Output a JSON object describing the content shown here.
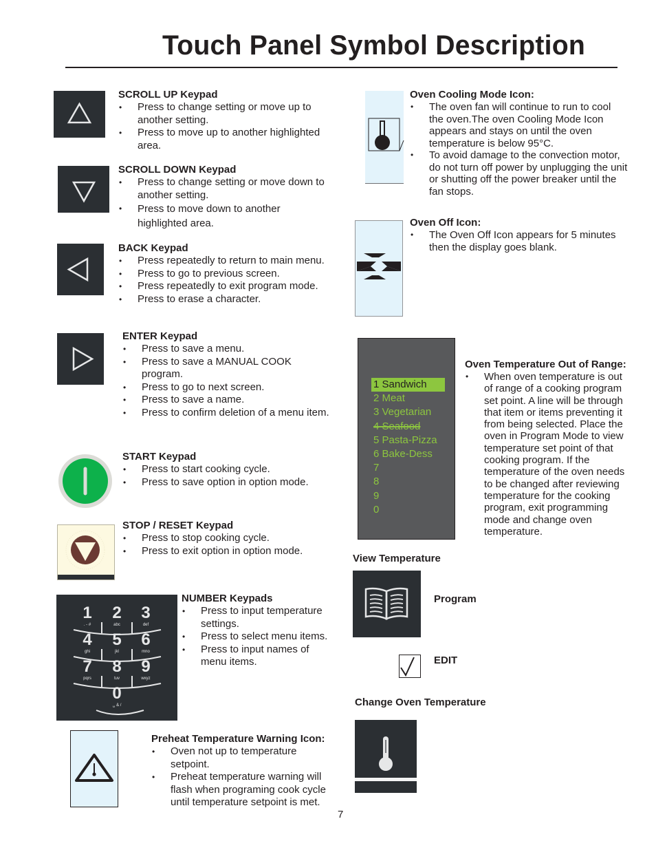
{
  "page": {
    "title": "Touch Panel Symbol Description",
    "page_number": "7"
  },
  "left_sections": {
    "scroll_up": {
      "icon": "triangle-up-icon",
      "heading": "SCROLL UP Keypad",
      "bullets": [
        "Press to change setting or move up to another setting.",
        "Press to move up to another highlighted area."
      ]
    },
    "scroll_down": {
      "icon": "triangle-down-icon",
      "heading": "SCROLL DOWN Keypad",
      "bullets": [
        "Press to change setting or move down to another setting.",
        "Press to move down to another highlighted area."
      ]
    },
    "back": {
      "icon": "triangle-left-icon",
      "heading": "BACK Keypad",
      "bullets": [
        "Press repeatedly to return to main menu.",
        "Press to go to previous screen.",
        "Press repeatedly to exit program mode.",
        "Press to erase a character."
      ]
    },
    "enter": {
      "icon": "triangle-right-icon",
      "heading": "ENTER Keypad",
      "bullets": [
        "Press to save a menu.",
        "Press to save a MANUAL COOK program.",
        "Press to go to next screen.",
        "Press to save a name.",
        "Press to confirm deletion of a menu item."
      ]
    },
    "start": {
      "icon": "start-button-icon",
      "heading": "START Keypad",
      "bullets": [
        "Press to start cooking cycle.",
        "Press to save option in option mode."
      ],
      "color": "#0db14b"
    },
    "stop": {
      "icon": "stop-reset-icon",
      "heading": "STOP / RESET Keypad",
      "bullets": [
        "Press to stop cooking cycle.",
        "Press to exit option in option mode."
      ],
      "color": "#6b3a33"
    },
    "number": {
      "icon": "number-keypad-icon",
      "heading": "NUMBER Keypads",
      "bullets": [
        "Press to input temperature settings.",
        "Press to select menu items.",
        "Press to input names of menu items."
      ],
      "keys": [
        {
          "digit": "1",
          "letters": ". - #"
        },
        {
          "digit": "2",
          "letters": "abc"
        },
        {
          "digit": "3",
          "letters": "def"
        },
        {
          "digit": "4",
          "letters": "ghi"
        },
        {
          "digit": "5",
          "letters": "jkl"
        },
        {
          "digit": "6",
          "letters": "mno"
        },
        {
          "digit": "7",
          "letters": "pqrs"
        },
        {
          "digit": "8",
          "letters": "tuv"
        },
        {
          "digit": "9",
          "letters": "wxyz"
        },
        {
          "digit": "0",
          "letters": "␣ & /"
        }
      ]
    },
    "preheat": {
      "icon": "preheat-warning-icon",
      "heading": "Preheat Temperature Warning Icon:",
      "bullets": [
        "Oven not up to temperature setpoint.",
        "Preheat temperature warning will flash when programing cook cycle until temperature setpoint is met."
      ]
    }
  },
  "right_sections": {
    "cooling": {
      "icon": "thermometer-cooling-icon",
      "heading": "Oven Cooling Mode Icon:",
      "bullets": [
        "The oven fan will continue to run to cool the oven.The oven Cooling Mode Icon appears and stays on until the oven temperature is below 95°C.",
        "To avoid damage to the convection motor, do not turn off power by unplugging the unit or shutting off the power breaker until the fan stops."
      ]
    },
    "oven_off": {
      "icon": "oven-off-x-icon",
      "heading": "Oven Off Icon:",
      "bullets": [
        "The Oven Off Icon appears for 5 minutes then the display goes blank."
      ]
    },
    "out_of_range": {
      "heading": "Oven Temperature Out of Range:",
      "bullets": [
        "When oven temperature is out of range of a cooking program set point. A line will be through that item or items preventing it from being selected. Place the oven in Program Mode to view temperature set point of that cooking program. If the temperature of the oven needs to be changed after reviewing temperature for the cooking program, exit programming mode and change oven temperature."
      ],
      "menu": [
        {
          "label": "1 Sandwich",
          "state": "selected"
        },
        {
          "label": "2 Meat",
          "state": "normal"
        },
        {
          "label": "3 Vegetarian",
          "state": "normal"
        },
        {
          "label": "4 Seafood",
          "state": "disabled"
        },
        {
          "label": "5 Pasta-Pizza",
          "state": "normal"
        },
        {
          "label": "6 Bake-Dess",
          "state": "normal"
        },
        {
          "label": "7",
          "state": "normal"
        },
        {
          "label": "8",
          "state": "normal"
        },
        {
          "label": "9",
          "state": "normal"
        },
        {
          "label": "0",
          "state": "normal"
        }
      ],
      "accent": "#8dc63f"
    },
    "view_temperature": {
      "label": "View Temperature"
    },
    "program": {
      "icon": "open-book-icon",
      "label": "Program"
    },
    "edit": {
      "icon": "checkmark-icon",
      "label": "EDIT"
    },
    "change_temp": {
      "icon": "thermometer-icon",
      "label": "Change Oven Temperature"
    }
  }
}
